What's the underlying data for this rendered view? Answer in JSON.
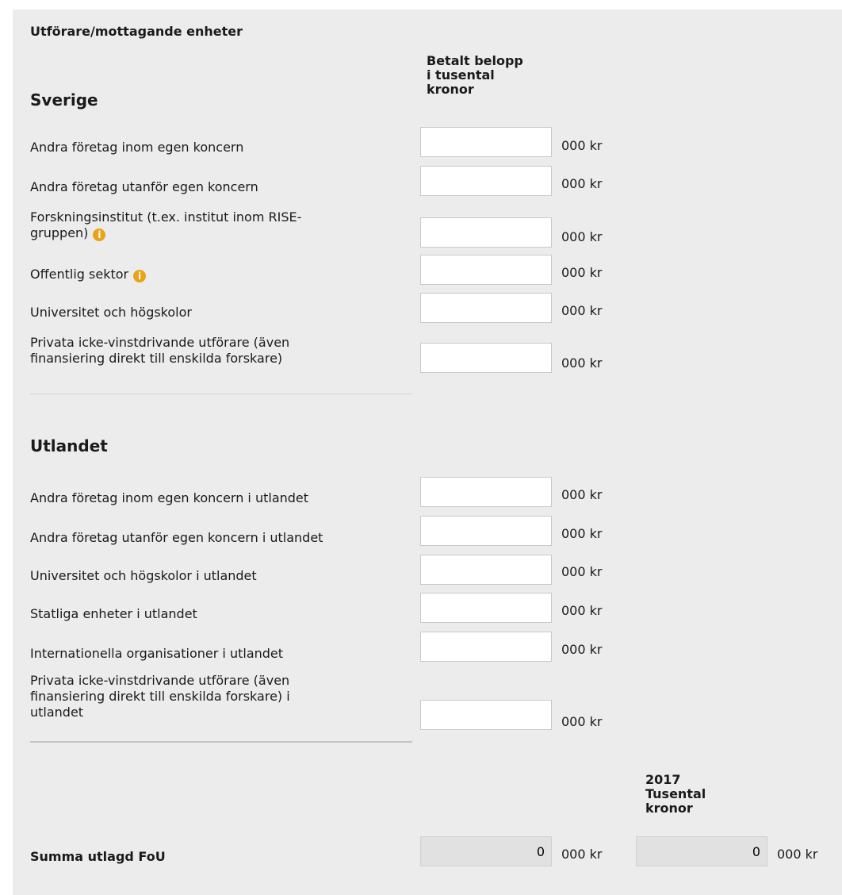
{
  "form_title": "Utförare/mottagande enheter",
  "column_header": [
    "Betalt belopp",
    "i tusental",
    "kronor"
  ],
  "unit": "000 kr",
  "sverige": {
    "heading": "Sverige",
    "rows": [
      {
        "label": "Andra företag inom egen koncern",
        "value": ""
      },
      {
        "label": "Andra företag utanför egen koncern",
        "value": ""
      },
      {
        "label_lines": [
          "Forskningsinstitut (t.ex. institut inom RISE-",
          "gruppen)"
        ],
        "info": true,
        "value": ""
      },
      {
        "label": "Offentlig sektor",
        "info": true,
        "value": ""
      },
      {
        "label": "Universitet och högskolor",
        "value": ""
      },
      {
        "label_lines": [
          "Privata icke-vinstdrivande utförare (även",
          "finansiering direkt till enskilda forskare)"
        ],
        "value": ""
      }
    ]
  },
  "utlandet": {
    "heading": "Utlandet",
    "rows": [
      {
        "label": "Andra företag inom egen koncern i utlandet",
        "value": ""
      },
      {
        "label": "Andra företag utanför egen koncern i utlandet",
        "value": ""
      },
      {
        "label": "Universitet och högskolor i utlandet",
        "value": ""
      },
      {
        "label": "Statliga enheter i utlandet",
        "value": ""
      },
      {
        "label": "Internationella organisationer i utlandet",
        "value": ""
      },
      {
        "label_lines": [
          "Privata icke-vinstdrivande utförare (även",
          "finansiering direkt till enskilda forskare) i",
          "utlandet"
        ],
        "value": ""
      }
    ]
  },
  "summary": {
    "year_header": [
      "2017",
      "Tusental",
      "kronor"
    ],
    "label": "Summa utlagd FoU",
    "current_value": "0",
    "year_value": "0"
  },
  "info_icon": "info-icon",
  "colors": {
    "panel_bg": "#ececec",
    "input_bg": "#ffffff",
    "readonly_bg": "#e1e1e1",
    "info_orange": "#e8a317"
  }
}
